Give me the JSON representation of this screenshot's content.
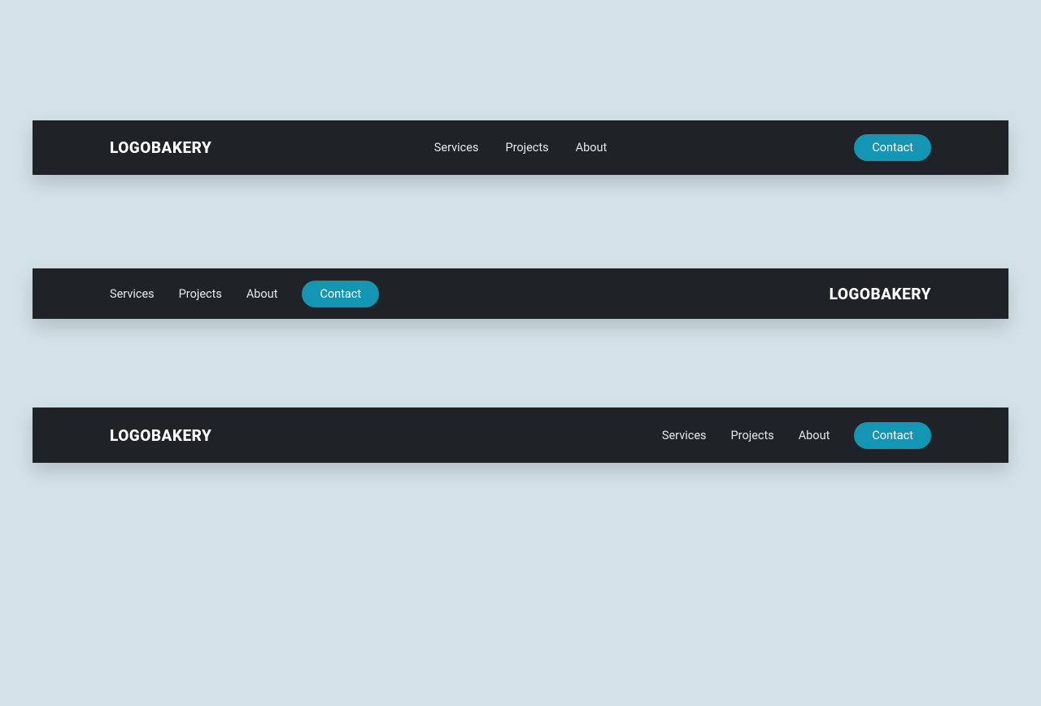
{
  "brand": "LOGOBAKERY",
  "nav": {
    "links": [
      "Services",
      "Projects",
      "About"
    ],
    "cta": "Contact"
  }
}
